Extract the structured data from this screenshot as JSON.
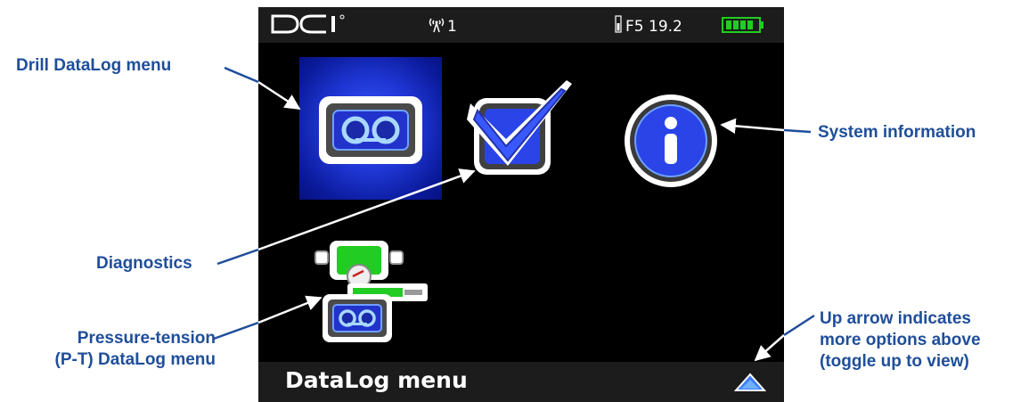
{
  "device": {
    "logo_text": "DCI",
    "signal_value": "1",
    "frequency_text": "F5 19.2",
    "footer_title": "DataLog menu",
    "colors": {
      "screen_bg": "#000000",
      "bar_bg": "#1c1c1c",
      "highlight": "#2a44e8",
      "battery": "#22cc22",
      "callout": "#1f4e9a"
    }
  },
  "menu": {
    "items": [
      {
        "icon": "drill-datalog-icon",
        "selected": true
      },
      {
        "icon": "diagnostics-icon",
        "selected": false
      },
      {
        "icon": "system-info-icon",
        "selected": false
      },
      {
        "icon": "pt-datalog-icon",
        "selected": false
      }
    ],
    "up_arrow_icon": "up-arrow-icon"
  },
  "callouts": {
    "drill": "Drill DataLog menu",
    "system": "System information",
    "diagnostics": "Diagnostics",
    "pt_line1": "Pressure-tension",
    "pt_line2": "(P-T) DataLog menu",
    "up_line1": "Up arrow indicates",
    "up_line2": "more options above",
    "up_line3": "(toggle up to view)"
  }
}
